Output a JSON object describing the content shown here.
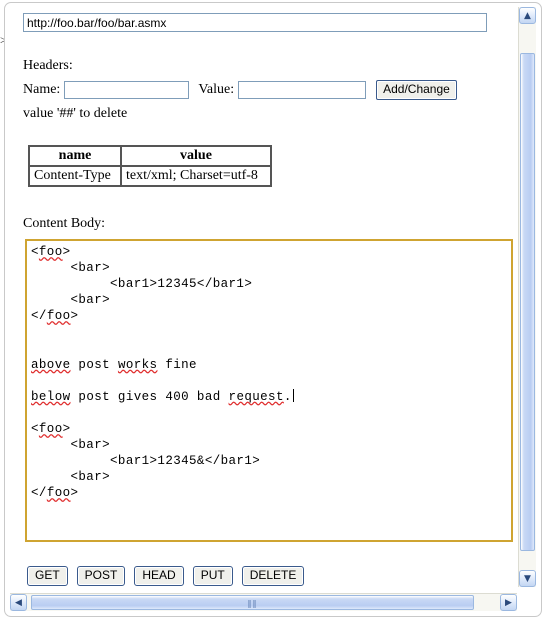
{
  "url_bar": {
    "value": "http://foo.bar/foo/bar.asmx",
    "placeholder": "http://"
  },
  "edge_artifact": {
    "glyph": ">"
  },
  "headers_section": {
    "title": "Headers:",
    "name_label": "Name:",
    "name_value": "",
    "name_placeholder": "",
    "value_label": "Value:",
    "value_value": "",
    "value_placeholder": "",
    "add_change_label": "Add/Change",
    "delete_hint": "value '##' to delete",
    "table": {
      "columns": [
        "name",
        "value"
      ],
      "rows": [
        [
          "Content-Type",
          "text/xml; Charset=utf-8"
        ]
      ]
    }
  },
  "content_body": {
    "label": "Content Body:",
    "lines": [
      "<foo>",
      "     <bar>",
      "          <bar1>12345</bar1>",
      "     <bar>",
      "</foo>",
      "",
      "",
      "above post works fine",
      "",
      "below post gives 400 bad request.",
      "",
      "<foo>",
      "     <bar>",
      "          <bar1>12345&</bar1>",
      "     <bar>",
      "</foo>"
    ],
    "misspelled_words": [
      "foo",
      "above",
      "works",
      "below",
      "request"
    ],
    "border_color": "#cfa431",
    "caret_after": "request."
  },
  "method_buttons": [
    {
      "label": "GET"
    },
    {
      "label": "POST"
    },
    {
      "label": "HEAD"
    },
    {
      "label": "PUT"
    },
    {
      "label": "DELETE"
    }
  ],
  "scrollbars": {
    "vertical": {
      "up_arrow": "▲",
      "down_arrow": "▼",
      "thumb_top_pct": 8,
      "thumb_size_pct": 86
    },
    "horizontal": {
      "left_arrow": "◀",
      "right_arrow": "▶",
      "grip": "‖‖",
      "thumb_left_pct": 4,
      "thumb_size_pct": 87
    }
  }
}
